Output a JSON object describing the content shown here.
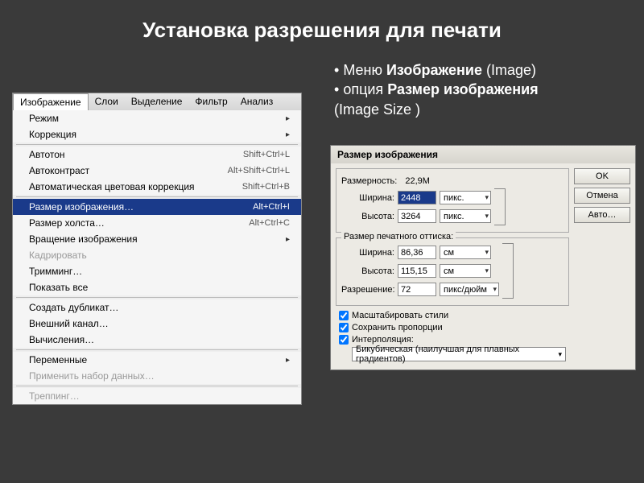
{
  "slide": {
    "title": "Установка разрешения для печати",
    "bullets": [
      {
        "pre": "Меню ",
        "bold": "Изображение",
        "post": " (Image)"
      },
      {
        "pre": " опция ",
        "bold": "Размер изображения",
        "post": ""
      },
      {
        "pre": "  (Image Size )",
        "bold": "",
        "post": ""
      }
    ]
  },
  "menu": {
    "bar": [
      "Изображение",
      "Слои",
      "Выделение",
      "Фильтр",
      "Анализ"
    ],
    "active_index": 0,
    "items": [
      {
        "label": "Режим",
        "sub": true
      },
      {
        "label": "Коррекция",
        "sub": true
      },
      {
        "sep": true
      },
      {
        "label": "Автотон",
        "shortcut": "Shift+Ctrl+L"
      },
      {
        "label": "Автоконтраст",
        "shortcut": "Alt+Shift+Ctrl+L"
      },
      {
        "label": "Автоматическая цветовая коррекция",
        "shortcut": "Shift+Ctrl+B"
      },
      {
        "sep": true
      },
      {
        "label": "Размер изображения…",
        "shortcut": "Alt+Ctrl+I",
        "selected": true
      },
      {
        "label": "Размер холста…",
        "shortcut": "Alt+Ctrl+C"
      },
      {
        "label": "Вращение изображения",
        "sub": true
      },
      {
        "label": "Кадрировать",
        "disabled": true
      },
      {
        "label": "Тримминг…"
      },
      {
        "label": "Показать все"
      },
      {
        "sep": true
      },
      {
        "label": "Создать дубликат…"
      },
      {
        "label": "Внешний канал…"
      },
      {
        "label": "Вычисления…"
      },
      {
        "sep": true
      },
      {
        "label": "Переменные",
        "sub": true
      },
      {
        "label": "Применить набор данных…",
        "disabled": true
      },
      {
        "sep": true
      },
      {
        "label": "Треппинг…",
        "disabled": true
      }
    ]
  },
  "dialog": {
    "title": "Размер изображения",
    "dim_label": "Размерность:",
    "dim_value": "22,9M",
    "pixel_group": {
      "legend": "",
      "width_label": "Ширина:",
      "width_value": "2448",
      "height_label": "Высота:",
      "height_value": "3264",
      "unit": "пикс."
    },
    "print_group": {
      "legend": "Размер печатного оттиска:",
      "width_label": "Ширина:",
      "width_value": "86,36",
      "height_label": "Высота:",
      "height_value": "115,15",
      "res_label": "Разрешение:",
      "res_value": "72",
      "len_unit": "см",
      "res_unit": "пикс/дюйм"
    },
    "checks": {
      "scale_styles": "Масштабировать стили",
      "constrain": "Сохранить пропорции",
      "interp": "Интерполяция:"
    },
    "interp_value": "Бикубическая (наилучшая для плавных градиентов)",
    "buttons": {
      "ok": "OK",
      "cancel": "Отмена",
      "auto": "Авто…"
    }
  }
}
